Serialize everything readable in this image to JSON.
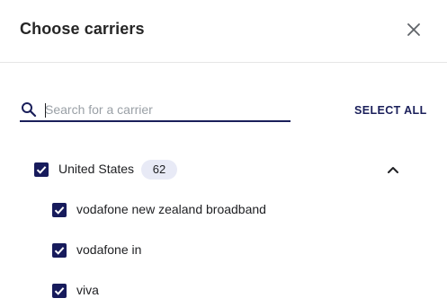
{
  "dialog": {
    "title": "Choose carriers",
    "close_icon": "close-icon"
  },
  "search": {
    "placeholder": "Search for a carrier",
    "value": "",
    "icon": "search-icon"
  },
  "select_all_label": "SELECT ALL",
  "colors": {
    "accent": "#171b5c",
    "badge_bg": "#e8eaf6"
  },
  "country": {
    "label": "United States",
    "count": "62",
    "checked": true,
    "expanded": true,
    "toggle_icon": "chevron-up-icon"
  },
  "carriers": [
    {
      "label": "vodafone new zealand broadband",
      "checked": true
    },
    {
      "label": "vodafone in",
      "checked": true
    },
    {
      "label": "viva",
      "checked": true
    }
  ]
}
